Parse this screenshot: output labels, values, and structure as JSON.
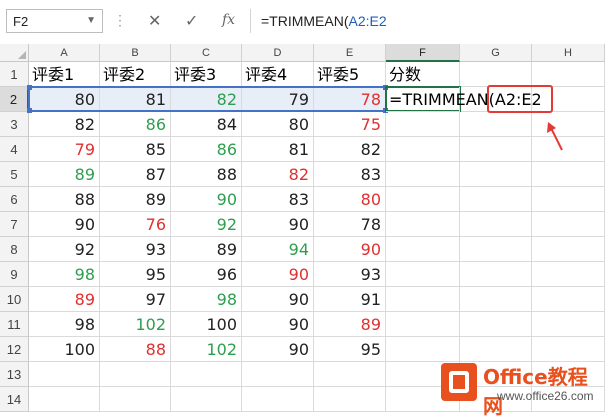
{
  "formula_bar": {
    "name_box": "F2",
    "cancel_icon": "✕",
    "enter_icon": "✓",
    "fx_label": "fx",
    "formula_prefix": "=TRIMMEAN(",
    "formula_ref": "A2:E2"
  },
  "columns": [
    "A",
    "B",
    "C",
    "D",
    "E",
    "F",
    "G",
    "H"
  ],
  "rows": [
    "1",
    "2",
    "3",
    "4",
    "5",
    "6",
    "7",
    "8",
    "9",
    "10",
    "11",
    "12",
    "13",
    "14"
  ],
  "headers": [
    "评委1",
    "评委2",
    "评委3",
    "评委4",
    "评委5",
    "分数"
  ],
  "table": [
    [
      {
        "v": "80",
        "c": "k"
      },
      {
        "v": "81",
        "c": "k"
      },
      {
        "v": "82",
        "c": "g"
      },
      {
        "v": "79",
        "c": "k"
      },
      {
        "v": "78",
        "c": "r"
      }
    ],
    [
      {
        "v": "82",
        "c": "k"
      },
      {
        "v": "86",
        "c": "g"
      },
      {
        "v": "84",
        "c": "k"
      },
      {
        "v": "80",
        "c": "k"
      },
      {
        "v": "75",
        "c": "r"
      }
    ],
    [
      {
        "v": "79",
        "c": "r"
      },
      {
        "v": "85",
        "c": "k"
      },
      {
        "v": "86",
        "c": "g"
      },
      {
        "v": "81",
        "c": "k"
      },
      {
        "v": "82",
        "c": "k"
      }
    ],
    [
      {
        "v": "89",
        "c": "g"
      },
      {
        "v": "87",
        "c": "k"
      },
      {
        "v": "88",
        "c": "k"
      },
      {
        "v": "82",
        "c": "r"
      },
      {
        "v": "83",
        "c": "k"
      }
    ],
    [
      {
        "v": "88",
        "c": "k"
      },
      {
        "v": "89",
        "c": "k"
      },
      {
        "v": "90",
        "c": "g"
      },
      {
        "v": "83",
        "c": "k"
      },
      {
        "v": "80",
        "c": "r"
      }
    ],
    [
      {
        "v": "90",
        "c": "k"
      },
      {
        "v": "76",
        "c": "r"
      },
      {
        "v": "92",
        "c": "g"
      },
      {
        "v": "90",
        "c": "k"
      },
      {
        "v": "78",
        "c": "k"
      }
    ],
    [
      {
        "v": "92",
        "c": "k"
      },
      {
        "v": "93",
        "c": "k"
      },
      {
        "v": "89",
        "c": "k"
      },
      {
        "v": "94",
        "c": "g"
      },
      {
        "v": "90",
        "c": "r"
      }
    ],
    [
      {
        "v": "98",
        "c": "g"
      },
      {
        "v": "95",
        "c": "k"
      },
      {
        "v": "96",
        "c": "k"
      },
      {
        "v": "90",
        "c": "r"
      },
      {
        "v": "93",
        "c": "k"
      }
    ],
    [
      {
        "v": "89",
        "c": "r"
      },
      {
        "v": "97",
        "c": "k"
      },
      {
        "v": "98",
        "c": "g"
      },
      {
        "v": "90",
        "c": "k"
      },
      {
        "v": "91",
        "c": "k"
      }
    ],
    [
      {
        "v": "98",
        "c": "k"
      },
      {
        "v": "102",
        "c": "g"
      },
      {
        "v": "100",
        "c": "k"
      },
      {
        "v": "90",
        "c": "k"
      },
      {
        "v": "89",
        "c": "r"
      }
    ],
    [
      {
        "v": "100",
        "c": "k"
      },
      {
        "v": "88",
        "c": "r"
      },
      {
        "v": "102",
        "c": "g"
      },
      {
        "v": "90",
        "c": "k"
      },
      {
        "v": "95",
        "c": "k"
      }
    ]
  ],
  "f2_formula": "=TRIMMEAN(",
  "f2_ref": "A2:E2",
  "colors": {
    "k": "#222222",
    "g": "#2e9e4f",
    "r": "#e03030",
    "accent": "#217346",
    "ref_blue": "#4472c4",
    "annotation": "#e53935"
  },
  "logo": {
    "name": "Office教程网",
    "site": "www.office26.com"
  }
}
